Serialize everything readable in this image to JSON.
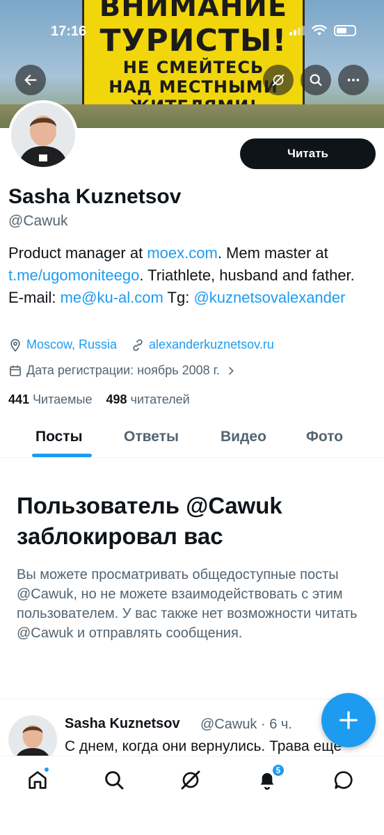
{
  "status_bar": {
    "time": "17:16"
  },
  "banner": {
    "line1": "ВНИМАНИЕ",
    "line2": "ТУРИСТЫ!",
    "line3": "НЕ СМЕЙТЕСЬ",
    "line4": "НАД МЕСТНЫМИ",
    "line5": "ЖИТЕЛЯМИ!"
  },
  "header": {
    "back_icon": "arrow-left-icon",
    "grok_icon": "grok-icon",
    "search_icon": "search-icon",
    "more_icon": "more-icon"
  },
  "profile": {
    "follow_button": "Читать",
    "name": "Sasha Kuznetsov",
    "handle": "@Cawuk",
    "bio": {
      "p1": "Product manager at ",
      "link1": "moex.com",
      "p2": ". Mem master at ",
      "link2": "t.me/ugomoniteego",
      "p3": ". Triathlete, husband and father. E-mail: ",
      "link3": "me@ku-al.com",
      "p4": " Tg: ",
      "link4": "@kuznetsovalexander"
    },
    "location": "Moscow, Russia",
    "website": "alexanderkuznetsov.ru",
    "joined": "Дата регистрации: ноябрь 2008 г.",
    "following_count": "441",
    "following_label": "Читаемые",
    "followers_count": "498",
    "followers_label": "читателей"
  },
  "tabs": [
    "Посты",
    "Ответы",
    "Видео",
    "Фото"
  ],
  "active_tab": "Посты",
  "blocked": {
    "title": "Пользователь @Cawuk заблокировал вас",
    "text": "Вы можете просматривать общедоступные посты @Cawuk, но не можете взаимодействовать с этим пользователем. У вас также нет возможности читать @Cawuk и отправлять сообщения."
  },
  "post": {
    "name": "Sasha Kuznetsov",
    "meta": "@Cawuk · 6 ч.",
    "text": "С днем, когда они вернулись. Трава ещё"
  },
  "nav": {
    "notifications_badge": "5",
    "items": [
      "home-icon",
      "search-icon",
      "grok-icon",
      "bell-icon",
      "messages-icon"
    ]
  },
  "colors": {
    "accent": "#1d9bf0",
    "text": "#0f1419",
    "secondary": "#536471"
  }
}
